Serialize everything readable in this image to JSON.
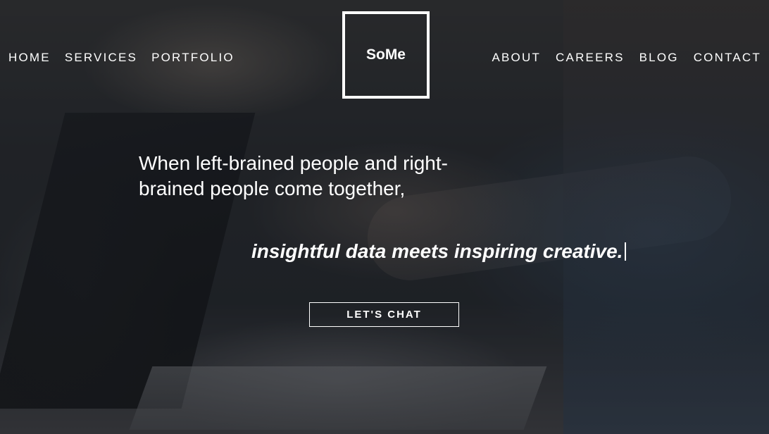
{
  "nav": {
    "left": [
      {
        "label": "HOME"
      },
      {
        "label": "SERVICES"
      },
      {
        "label": "PORTFOLIO"
      }
    ],
    "right": [
      {
        "label": "ABOUT"
      },
      {
        "label": "CAREERS"
      },
      {
        "label": "BLOG"
      },
      {
        "label": "CONTACT"
      }
    ]
  },
  "logo": {
    "text": "SoMe"
  },
  "hero": {
    "headline": "When left-brained people and right-brained people come together,",
    "tagline": "insightful data meets inspiring creative.",
    "cta_label": "LET'S CHAT"
  },
  "colors": {
    "text": "#ffffff",
    "overlay": "#14161a"
  }
}
